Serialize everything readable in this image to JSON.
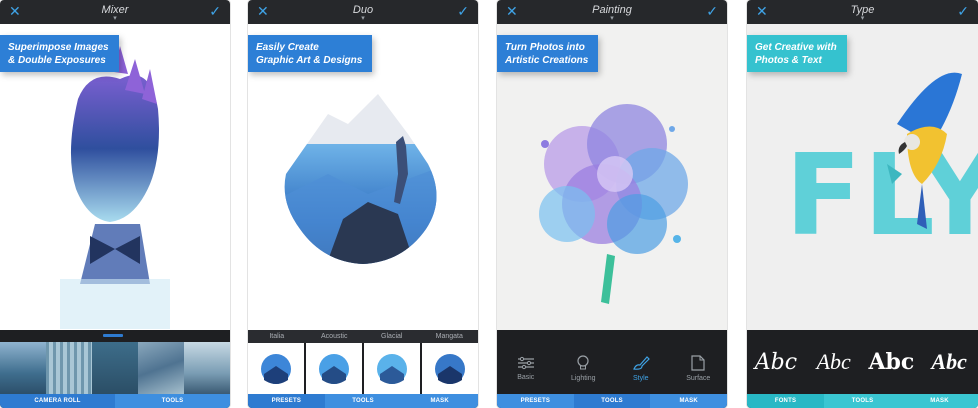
{
  "panels": [
    {
      "title": "Mixer",
      "callout": [
        "Superimpose Images",
        "& Double Exposures"
      ],
      "tabs": [
        "CAMERA ROLL",
        "TOOLS"
      ]
    },
    {
      "title": "Duo",
      "callout": [
        "Easily Create",
        "Graphic Art & Designs"
      ],
      "presets": [
        "Italia",
        "Acoustic",
        "Glacial",
        "Mangata"
      ],
      "tabs": [
        "PRESETS",
        "TOOLS",
        "MASK"
      ]
    },
    {
      "title": "Painting",
      "callout": [
        "Turn Photos into",
        "Artistic Creations"
      ],
      "tools": [
        "Basic",
        "Lighting",
        "Style",
        "Surface"
      ],
      "tabs": [
        "PRESETS",
        "TOOLS",
        "MASK"
      ]
    },
    {
      "title": "Type",
      "callout": [
        "Get Creative with",
        "Photos & Text"
      ],
      "canvas_text": "FLY",
      "fonts": [
        "Abc",
        "Abc",
        "Abc",
        "Abc"
      ],
      "tabs": [
        "FONTS",
        "TOOLS",
        "MASK"
      ]
    }
  ],
  "colors": {
    "accent_blue": "#2e7bd1",
    "accent_teal": "#35c2cf",
    "dark_bar": "#1e1f22"
  },
  "icons": [
    "close-icon",
    "checkmark-icon",
    "sliders-icon",
    "bulb-icon",
    "brush-icon",
    "texture-icon"
  ]
}
